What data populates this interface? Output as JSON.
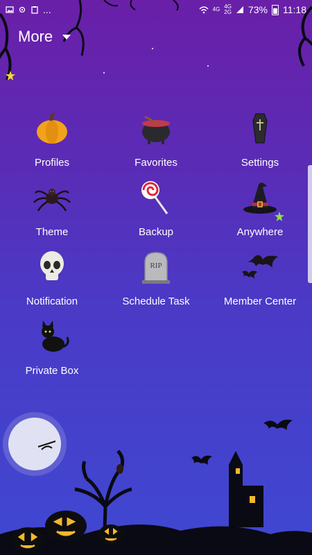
{
  "status_bar": {
    "battery_percent": "73%",
    "time": "11:18",
    "net_label_1": "4G",
    "net_label_2": "4G",
    "net_label_3": "2G",
    "icons": [
      "image-icon",
      "settings-dot-icon",
      "clipboard-icon",
      "more-dots-icon",
      "wifi-icon",
      "signal-icon",
      "battery-icon"
    ]
  },
  "header": {
    "title": "More"
  },
  "menu": [
    {
      "label": "Profiles",
      "icon": "pumpkin-icon"
    },
    {
      "label": "Favorites",
      "icon": "cauldron-icon"
    },
    {
      "label": "Settings",
      "icon": "coffin-icon"
    },
    {
      "label": "Theme",
      "icon": "spider-icon"
    },
    {
      "label": "Backup",
      "icon": "lollipop-icon"
    },
    {
      "label": "Anywhere",
      "icon": "witch-hat-icon"
    },
    {
      "label": "Notification",
      "icon": "skull-icon"
    },
    {
      "label": "Schedule Task",
      "icon": "tombstone-icon"
    },
    {
      "label": "Member Center",
      "icon": "bats-icon"
    },
    {
      "label": "Private Box",
      "icon": "black-cat-icon"
    }
  ],
  "tombstone_text": "RIP",
  "colors": {
    "background_top": "#6a1fa8",
    "background_bottom": "#3f48d2",
    "text": "#ffffff",
    "silhouette": "#0a0a14",
    "pumpkin": "#f3a21b",
    "moon": "#e8eaf6"
  }
}
